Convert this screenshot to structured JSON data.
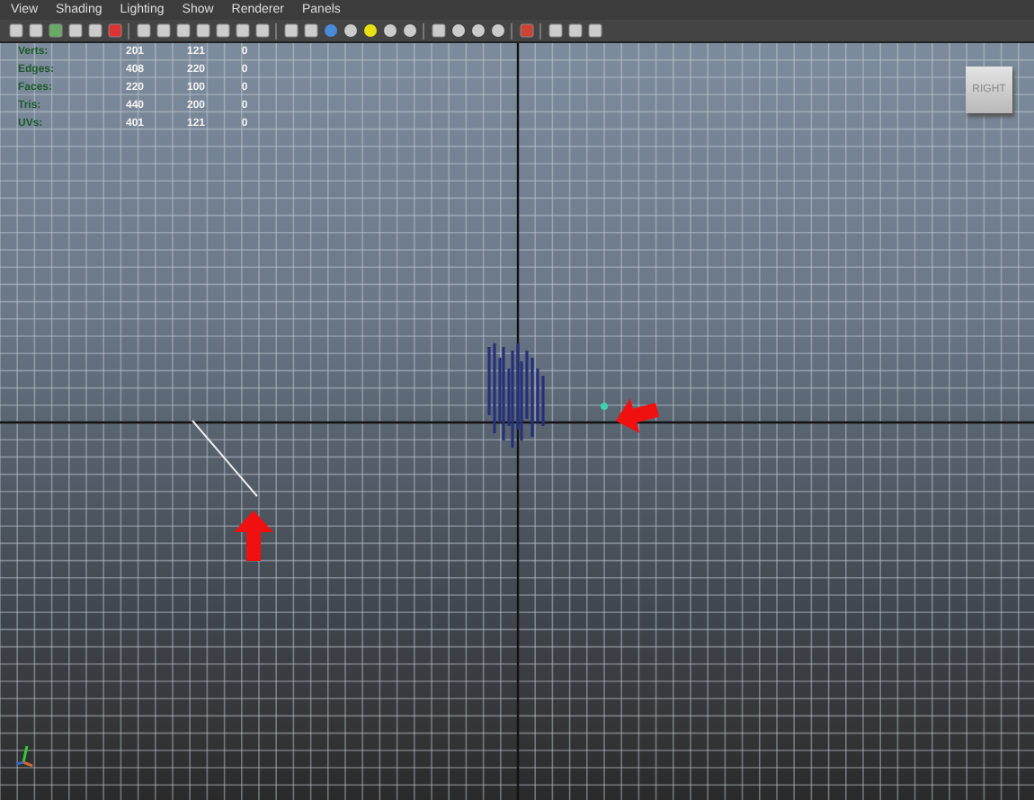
{
  "menu_bar": {
    "items": [
      "View",
      "Shading",
      "Lighting",
      "Show",
      "Renderer",
      "Panels"
    ]
  },
  "hud_stats": {
    "rows": [
      {
        "label": "Verts:",
        "values": [
          "201",
          "121",
          "0"
        ]
      },
      {
        "label": "Edges:",
        "values": [
          "408",
          "220",
          "0"
        ]
      },
      {
        "label": "Faces:",
        "values": [
          "220",
          "100",
          "0"
        ]
      },
      {
        "label": "Tris:",
        "values": [
          "440",
          "200",
          "0"
        ]
      },
      {
        "label": "UVs:",
        "values": [
          "401",
          "121",
          "0"
        ]
      }
    ]
  },
  "view_cube": {
    "label": "RIGHT"
  }
}
